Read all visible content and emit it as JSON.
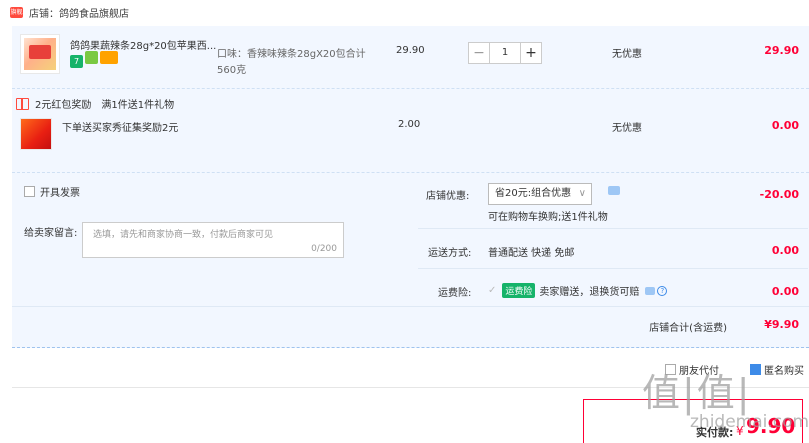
{
  "shop": {
    "label": "店铺：鸽鸽食品旗舰店",
    "logo_text": "旗舰"
  },
  "items": [
    {
      "title": "鸽鸽果蔬辣条28g*20包苹果西...",
      "sku": "口味：香辣味辣条28gX20包合计560克",
      "sku_line1": "口味：香辣味辣条28gX20包合计",
      "sku_line2": "560克",
      "unit_price": "29.90",
      "quantity": "1",
      "discount": "无优惠",
      "subtotal": "29.90",
      "tags": [
        "7",
        "",
        ""
      ]
    }
  ],
  "gift": {
    "promo_label": "2元红包奖励",
    "promo_rule": "满1件送1件礼物",
    "title": "下单送买家秀征集奖励2元",
    "unit_price": "2.00",
    "discount": "无优惠",
    "subtotal": "0.00"
  },
  "invoice": {
    "label": "开具发票"
  },
  "message": {
    "label": "给卖家留言:",
    "placeholder": "选填，请先和商家协商一致，付款后商家可见",
    "counter": "0/200"
  },
  "shop_discount": {
    "label": "店铺优惠:",
    "selected": "省20元:组合优惠",
    "note": "可在购物车换购;送1件礼物",
    "amount": "-20.00"
  },
  "shipping": {
    "label": "运送方式:",
    "value": "普通配送 快递 免邮",
    "amount": "0.00"
  },
  "insurance": {
    "label": "运费险:",
    "badge": "运费险",
    "text": "卖家赠送，退换货可赔",
    "amount": "0.00"
  },
  "store_total": {
    "label": "店铺合计(含运费)",
    "amount": "¥9.90"
  },
  "options": {
    "anonymous": "匿名购买",
    "friend_pay": "朋友代付"
  },
  "pay": {
    "label": "实付款:",
    "currency": "¥",
    "amount": "9.90"
  },
  "watermark": {
    "glyphs": "值|值|",
    "site": "zhidemai.com"
  },
  "colors": {
    "accent": "#ff0036",
    "panel": "#f2f7ff",
    "badge_green": "#16b36a"
  }
}
